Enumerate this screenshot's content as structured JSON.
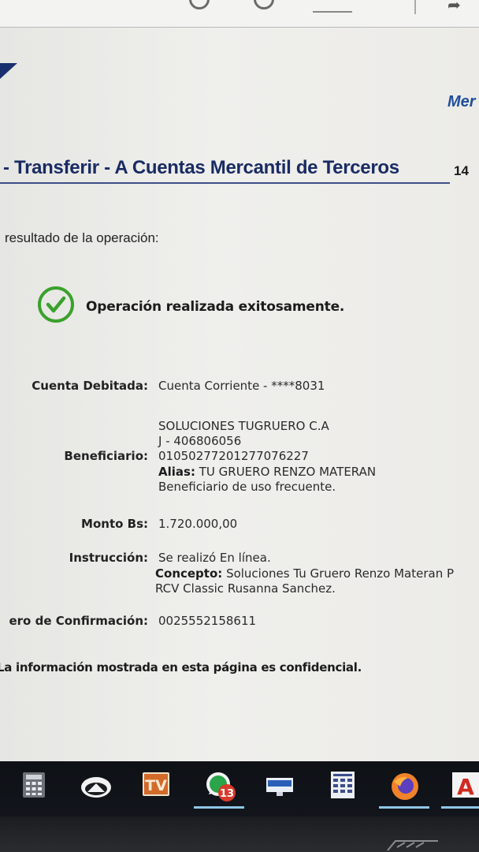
{
  "header": {
    "brand_fragment": "Mer",
    "title": "- Transferir - A Cuentas Mercantil de Terceros",
    "date_fragment": "14"
  },
  "result": {
    "label": "resultado de la operación:",
    "message": "Operación realizada exitosamente."
  },
  "details": {
    "cuenta_label": "Cuenta Debitada:",
    "cuenta_value": "Cuenta Corriente - ****8031",
    "beneficiario_label": "Beneficiario:",
    "beneficiario_name": "SOLUCIONES TUGRUERO C.A",
    "beneficiario_rif": "J - 406806056",
    "beneficiario_account": "01050277201277076227",
    "alias_label": "Alias:",
    "alias_value": "TU GRUERO RENZO MATERAN",
    "frequent_note": "Beneficiario de uso frecuente.",
    "monto_label": "Monto Bs:",
    "monto_value": "1.720.000,00",
    "instruccion_label": "Instrucción:",
    "instruccion_value": "Se realizó En línea.",
    "concepto_label": "Concepto:",
    "concepto_value_line1": "Soluciones Tu Gruero Renzo Materan P",
    "concepto_value_line2": "RCV Classic Rusanna Sanchez.",
    "confirmacion_label": "ero de Confirmación:",
    "confirmacion_value": "0025552158611"
  },
  "footer": {
    "confidential": "La información mostrada en esta página es confidencial."
  },
  "taskbar": {
    "whatsapp_badge": "13",
    "icons": [
      "calculator-icon",
      "cloud-icon",
      "tv-app-icon",
      "whatsapp-icon",
      "tv-channel-icon",
      "spreadsheet-icon",
      "firefox-icon",
      "acrobat-icon"
    ]
  },
  "colors": {
    "title_blue": "#1a2b63",
    "brand_blue": "#1f4f9a",
    "success_green": "#3aa12c",
    "taskbar": "#0e1116"
  }
}
